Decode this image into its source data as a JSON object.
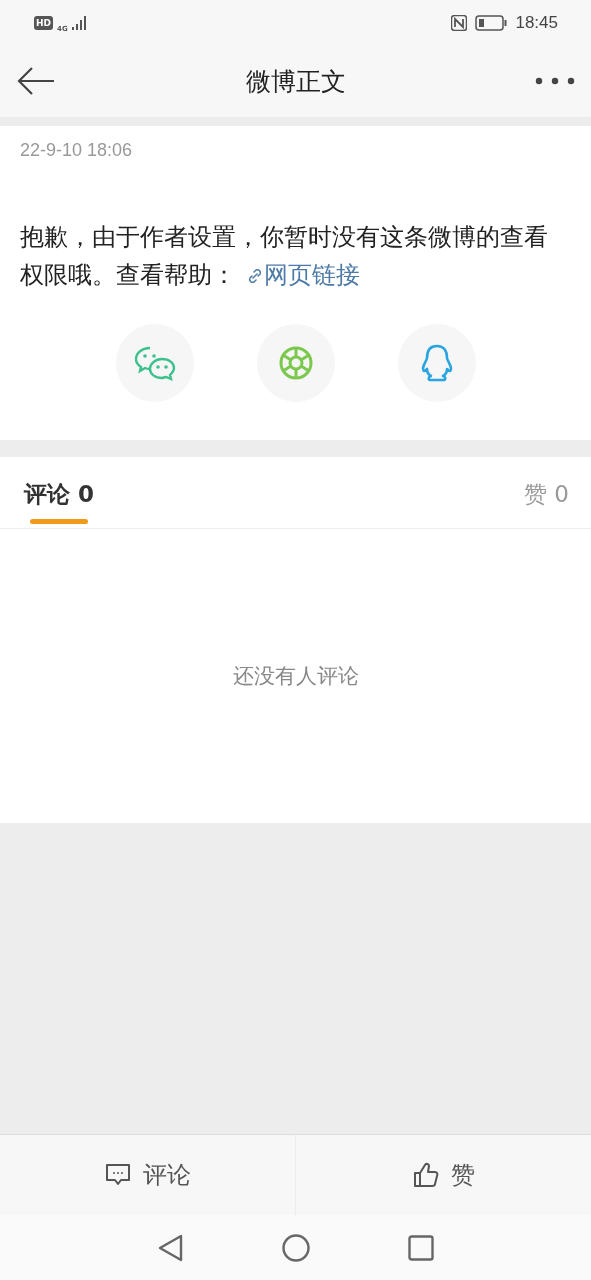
{
  "status_bar": {
    "hd": "HD",
    "network": "4G",
    "time": "18:45"
  },
  "header": {
    "title": "微博正文"
  },
  "post": {
    "date": "22-9-10 18:06",
    "message": "抱歉，由于作者设置，你暂时没有这条微博的查看权限哦。查看帮助：",
    "link": "网页链接"
  },
  "share_buttons": [
    {
      "kind": "wechat"
    },
    {
      "kind": "moments"
    },
    {
      "kind": "qq"
    }
  ],
  "tabs": [
    {
      "label": "评论 0",
      "selected": true
    },
    {
      "label": "赞 0",
      "selected": false
    }
  ],
  "empty_text": "还没有人评论",
  "actions": [
    {
      "kind": "comment",
      "label": "评论"
    },
    {
      "kind": "like",
      "label": "赞"
    }
  ]
}
